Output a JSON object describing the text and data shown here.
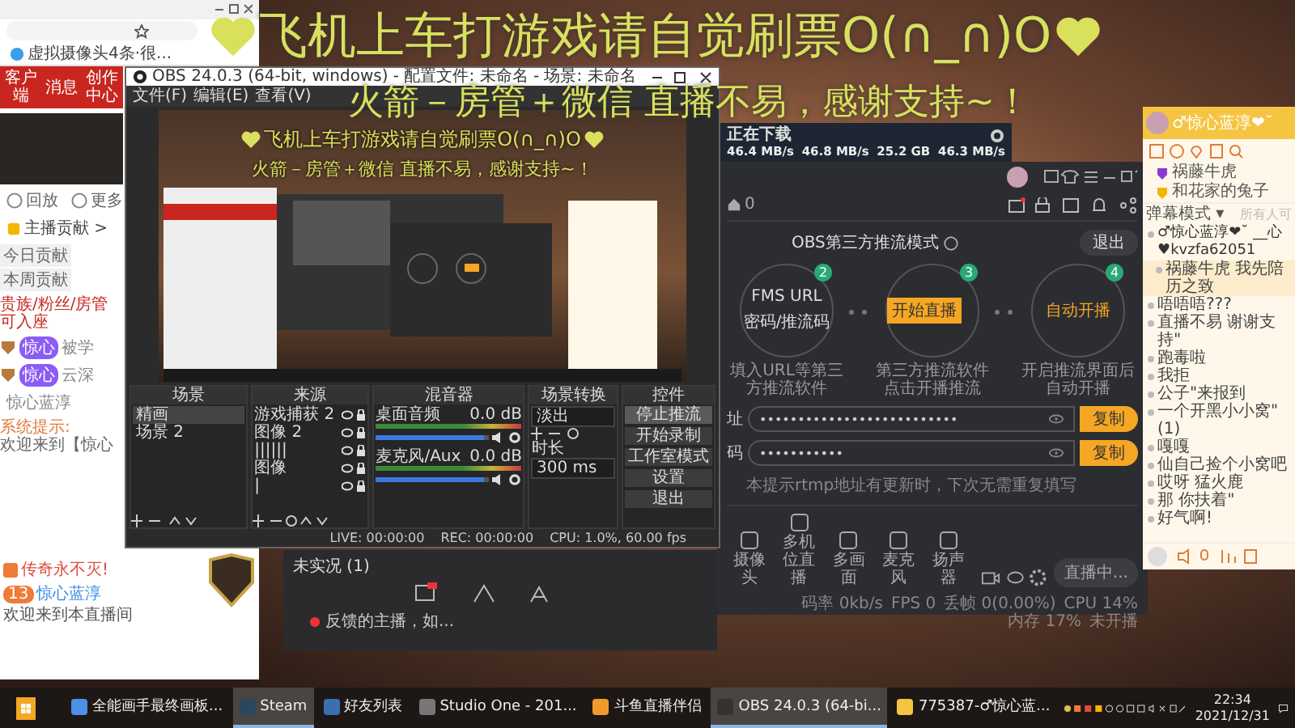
{
  "overlay": {
    "lines": [
      "飞机上车打游戏请自觉刷票O(∩_∩)O",
      "火箭－房管＋微信 直播不易，感谢支持~！"
    ]
  },
  "browser": {
    "bookmark": "虚拟摄像头4条·很...",
    "nav": [
      "客户端",
      "消息",
      "创作中心"
    ],
    "actions": [
      "回放",
      "更多"
    ],
    "rank_title": "主播贡献 >",
    "rank_tabs": [
      "今日贡献",
      "本周贡献"
    ],
    "rank_note": "贵族/粉丝/房管可入座",
    "fans": [
      {
        "badge": "惊心",
        "name": "被学"
      },
      {
        "badge": "惊心",
        "name": "云深"
      }
    ],
    "host_name": "惊心蓝淳",
    "system_tag": "系统提示:",
    "system_text": "欢迎来到【惊心",
    "notice": "传奇永不灭!",
    "welcome": {
      "badge": "13",
      "name": "惊心蓝淳",
      "text": "欢迎来到本直播间"
    }
  },
  "steam": {
    "title": "正在下载",
    "stats": [
      "46.4 MB/s",
      "46.8 MB/s",
      "25.2 GB",
      "46.3 MB/s"
    ]
  },
  "obs": {
    "title": "OBS 24.0.3 (64-bit, windows) - 配置文件: 未命名 - 场景: 未命名",
    "menu": [
      "文件(F)",
      "编辑(E)",
      "查看(V)"
    ],
    "preview_lines": [
      "飞机上车打游戏请自觉刷票O(∩_∩)O",
      "火箭－房管＋微信 直播不易，感谢支持~！"
    ],
    "scenes": {
      "title": "场景",
      "items": [
        {
          "label": "精画",
          "selected": true
        },
        {
          "label": "场景 2",
          "selected": false
        }
      ]
    },
    "sources": {
      "title": "来源",
      "items": [
        "游戏捕获 2",
        "图像 2",
        "||||||",
        "图像",
        "|"
      ]
    },
    "mixer": {
      "title": "混音器",
      "channels": [
        {
          "name": "桌面音频",
          "reading": "0.0 dB",
          "level": 0.95
        },
        {
          "name": "麦克风/Aux",
          "reading": "0.0 dB",
          "level": 0.95
        }
      ]
    },
    "transitions": {
      "title": "场景转换",
      "value": "淡出",
      "duration_label": "时长",
      "duration": "300 ms"
    },
    "controls": {
      "title": "控件",
      "buttons": [
        "停止推流",
        "开始录制",
        "工作室模式",
        "设置",
        "退出"
      ]
    },
    "status": [
      "LIVE: 00:00:00",
      "REC: 00:00:00",
      "CPU: 1.0%, 60.00 fps"
    ]
  },
  "lower_window": {
    "title": "未实况 (1)",
    "notice": "反馈的主播，如..."
  },
  "live_app": {
    "room_count": "0",
    "mode_title": "OBS第三方推流模式",
    "exit": "退出",
    "steps": [
      {
        "badge": "2",
        "kind": "text",
        "lines": [
          "FMS URL",
          "密码/推流码"
        ],
        "caption": "填入URL等第三方推流软件"
      },
      {
        "badge": "3",
        "kind": "button",
        "lines": [
          "开始直播"
        ],
        "caption": "第三方推流软件点击开播推流"
      },
      {
        "badge": "4",
        "kind": "text",
        "lines": [
          "自动开播"
        ],
        "caption": "开启推流界面后自动开播"
      }
    ],
    "fields": [
      {
        "label": "址",
        "value": "••••••••••••••••••••••••••",
        "button": "复制"
      },
      {
        "label": "码",
        "value": "•••••••••••",
        "button": "复制"
      }
    ],
    "note": "本提示rtmp地址有更新时，下次无需重复填写",
    "tools": [
      "摄像头",
      "多机位直播",
      "多画面",
      "麦克风",
      "扬声器"
    ],
    "live_button": "直播中...",
    "status": [
      "码率 0kb/s",
      "FPS 0",
      "丢帧 0(0.00%)",
      "CPU 14%",
      "内存 17%",
      "未开播"
    ]
  },
  "chat": {
    "title": "♂惊心蓝淳❤˘",
    "users": [
      "祸藤牛虎",
      "和花家的兔子"
    ],
    "mode": "弹幕模式 ▾",
    "mode_hint": "所有人可",
    "messages": [
      {
        "kind": "host",
        "text": "♂惊心蓝淳❤˘ __心♥kvzfa62051"
      },
      {
        "kind": "reply",
        "text": "祸藤牛虎 我先陪历之致"
      },
      {
        "kind": "plain",
        "text": "唔唔唔???"
      },
      {
        "kind": "plain",
        "text": "直播不易 谢谢支持\""
      },
      {
        "kind": "plain",
        "text": "跑毒啦"
      },
      {
        "kind": "plain",
        "text": "我拒"
      },
      {
        "kind": "plain",
        "text": "公子\"来报到"
      },
      {
        "kind": "plain",
        "text": "一个开黑小小窝\"(1)"
      },
      {
        "kind": "plain",
        "text": "嘎嘎"
      },
      {
        "kind": "plain",
        "text": "仙自己捡个小窝吧"
      },
      {
        "kind": "plain",
        "text": "哎呀 猛火鹿"
      },
      {
        "kind": "plain",
        "text": "那 你扶着\""
      },
      {
        "kind": "plain",
        "text": "好气啊!"
      }
    ]
  },
  "taskbar": {
    "items": [
      {
        "label": "全能画手最终画板...",
        "selected": false
      },
      {
        "label": "Steam",
        "selected": true
      },
      {
        "label": "好友列表",
        "selected": false
      },
      {
        "label": "Studio One - 201...",
        "selected": false
      },
      {
        "label": "斗鱼直播伴侣",
        "selected": false
      },
      {
        "label": "OBS 24.0.3 (64-bi...",
        "selected": true
      },
      {
        "label": "775387-♂惊心蓝...",
        "selected": false
      }
    ],
    "time": "22:34",
    "date": "2021/12/31"
  }
}
